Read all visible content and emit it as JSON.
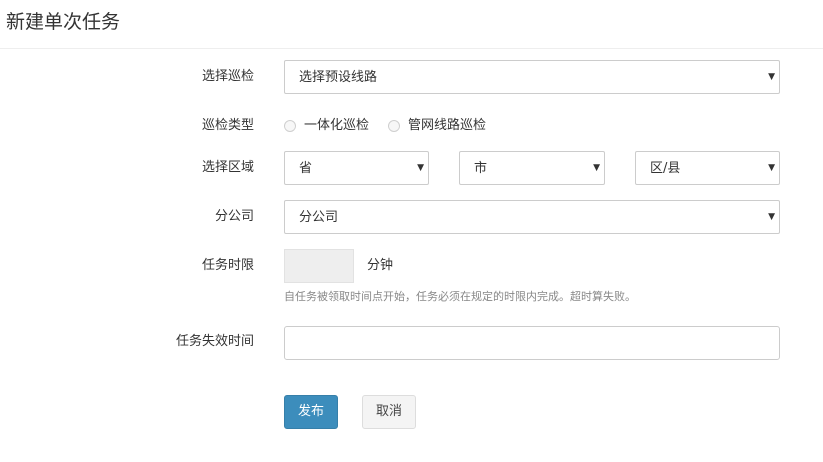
{
  "page_title": "新建单次任务",
  "form": {
    "route": {
      "label": "选择巡检",
      "value": "选择预设线路"
    },
    "inspection_type": {
      "label": "巡检类型",
      "options": [
        "一体化巡检",
        "管网线路巡检"
      ]
    },
    "region": {
      "label": "选择区域",
      "province": "省",
      "city": "市",
      "district": "区/县"
    },
    "branch": {
      "label": "分公司",
      "value": "分公司"
    },
    "time_limit": {
      "label": "任务时限",
      "value": "",
      "unit": "分钟",
      "help": "自任务被领取时间点开始，任务必须在规定的时限内完成。超时算失败。"
    },
    "expire_time": {
      "label": "任务失效时间",
      "value": ""
    }
  },
  "buttons": {
    "publish": "发布",
    "cancel": "取消"
  },
  "icons": {
    "dropdown": "caret-down-icon",
    "radio": "radio-unchecked-icon"
  },
  "colors": {
    "primary": "#3c8dbc",
    "border": "#cccccc",
    "help_text": "#888888"
  }
}
